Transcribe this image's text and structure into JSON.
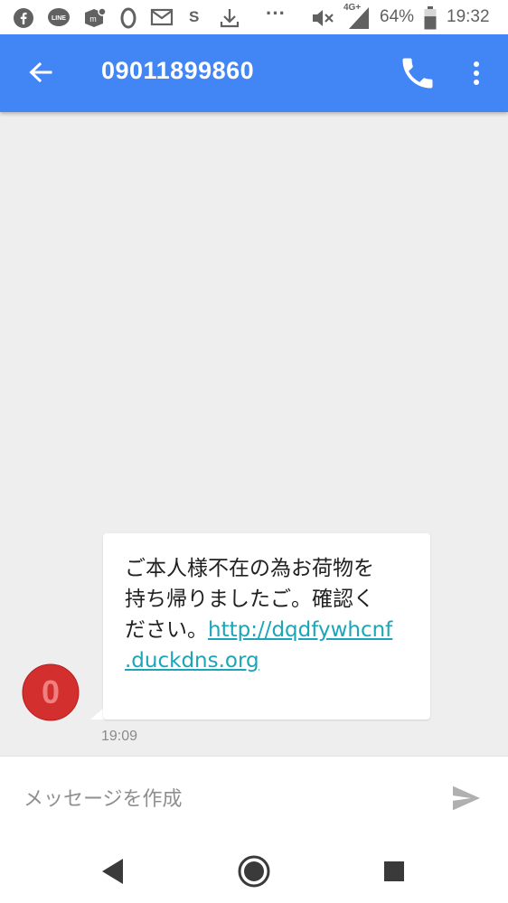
{
  "status_bar": {
    "notification_icons": [
      "facebook-icon",
      "line-icon",
      "mercari-icon",
      "ring-icon",
      "mail-icon",
      "s-icon",
      "download-icon",
      "more-notifications-icon"
    ],
    "s_label": "S",
    "overflow_label": "···",
    "network_type": "4G+",
    "battery_percent": "64%",
    "battery_level": 0.64,
    "time": "19:32"
  },
  "app_bar": {
    "title": "09011899860",
    "color": "#4285f4"
  },
  "conversation": {
    "avatar_letter": "0",
    "avatar_color": "#d32f2f",
    "messages": [
      {
        "text": "ご本人様不在の為お荷物を\n持ち帰りましたご。確認く\nださい。",
        "link": "http://dqdfywhcnf\n.duckdns.org",
        "time": "19:09"
      }
    ]
  },
  "compose": {
    "placeholder": "メッセージを作成"
  },
  "nav_bar": {
    "buttons": [
      "back-triangle-icon",
      "home-circle-icon",
      "recents-square-icon"
    ]
  }
}
